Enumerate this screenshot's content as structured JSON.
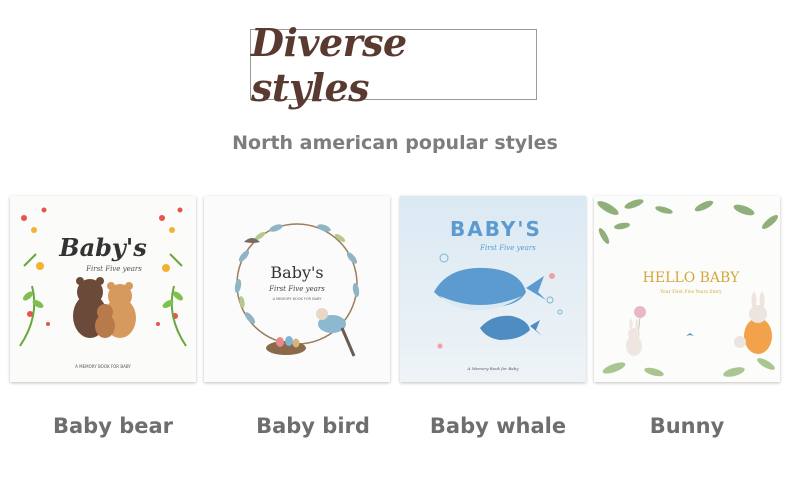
{
  "header": {
    "title": "Diverse styles"
  },
  "subtitle": "North american popular styles",
  "products": [
    {
      "caption": "Baby bear",
      "cover_title": "Baby's",
      "cover_subtitle": "First Five years",
      "cover_footer": "A MEMORY BOOK FOR BABY"
    },
    {
      "caption": "Baby bird",
      "cover_title": "Baby's",
      "cover_subtitle": "First Five years",
      "cover_footer": "A MEMORY BOOK FOR BABY"
    },
    {
      "caption": "Baby whale",
      "cover_title": "BABY'S",
      "cover_subtitle": "First Five years",
      "cover_footer": "A Memory Book for Baby"
    },
    {
      "caption": "Bunny",
      "cover_title": "HELLO BABY",
      "cover_subtitle": "Your First Five Years Story"
    }
  ],
  "colors": {
    "title_brown": "#5a3a30",
    "caption_gray": "#6e6e6e",
    "whale_blue": "#5b9bd0",
    "bunny_gold": "#d4a73c"
  },
  "icons": [
    "bear-illustration",
    "bird-wreath-illustration",
    "whale-illustration",
    "bunny-illustration"
  ]
}
